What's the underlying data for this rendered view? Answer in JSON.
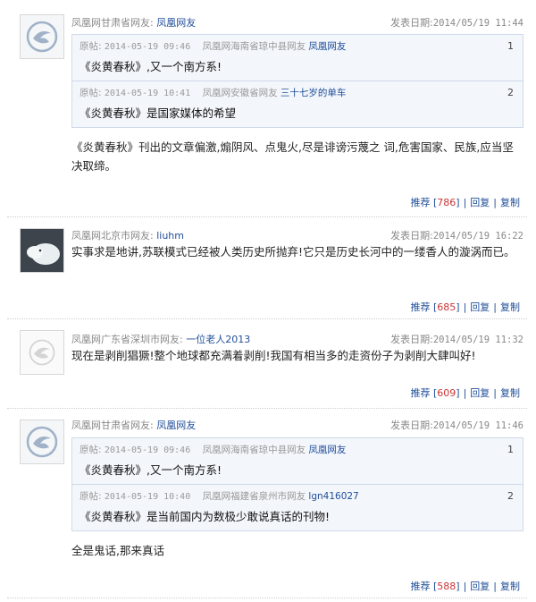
{
  "comments": [
    {
      "location": "凤凰网甘肃省网友:",
      "user": "凤凰网友",
      "date_label": "发表日期:",
      "date": "2014/05/19 11:44",
      "quotes": [
        {
          "label": "原帖:",
          "date": "2014-05-19 09:46",
          "location": "凤凰网海南省琼中县网友",
          "user": "凤凰网友",
          "num": "1",
          "text": "《炎黄春秋》,又一个南方系!"
        },
        {
          "label": "原帖:",
          "date": "2014-05-19 10:41",
          "location": "凤凰网安徽省网友",
          "user": "三十七岁的单车",
          "num": "2",
          "text": "《炎黄春秋》是国家媒体的希望"
        }
      ],
      "body": "《炎黄春秋》刊出的文章偏激,煽阴风、点鬼火,尽是诽谤污蔑之 词,危害国家、民族,应当坚决取缔。",
      "actions": {
        "recommend": "推荐",
        "count": "786",
        "reply": "回复",
        "copy": "复制"
      }
    },
    {
      "location": "凤凰网北京市网友:",
      "user": "liuhm",
      "date_label": "发表日期:",
      "date": "2014/05/19 16:22",
      "quotes": [],
      "body": "实事求是地讲,苏联模式已经被人类历史所抛弃!它只是历史长河中的一缕香人的漩涡而已。",
      "actions": {
        "recommend": "推荐",
        "count": "685",
        "reply": "回复",
        "copy": "复制"
      }
    },
    {
      "location": "凤凰网广东省深圳市网友:",
      "user": "一位老人2013",
      "date_label": "发表日期:",
      "date": "2014/05/19 11:32",
      "quotes": [],
      "body": "现在是剥削猖獗!整个地球都充满着剥削!我国有相当多的走资份子为剥削大肆叫好!",
      "actions": {
        "recommend": "推荐",
        "count": "609",
        "reply": "回复",
        "copy": "复制"
      }
    },
    {
      "location": "凤凰网甘肃省网友:",
      "user": "凤凰网友",
      "date_label": "发表日期:",
      "date": "2014/05/19 11:46",
      "quotes": [
        {
          "label": "原帖:",
          "date": "2014-05-19 09:46",
          "location": "凤凰网海南省琼中县网友",
          "user": "凤凰网友",
          "num": "1",
          "text": "《炎黄春秋》,又一个南方系!"
        },
        {
          "label": "原帖:",
          "date": "2014-05-19 10:40",
          "location": "凤凰网福建省泉州市网友",
          "user": "lgn416027",
          "num": "2",
          "text": "《炎黄春秋》是当前国内为数极少敢说真话的刊物!"
        }
      ],
      "body": "全是鬼话,那来真话",
      "actions": {
        "recommend": "推荐",
        "count": "588",
        "reply": "回复",
        "copy": "复制"
      }
    }
  ]
}
